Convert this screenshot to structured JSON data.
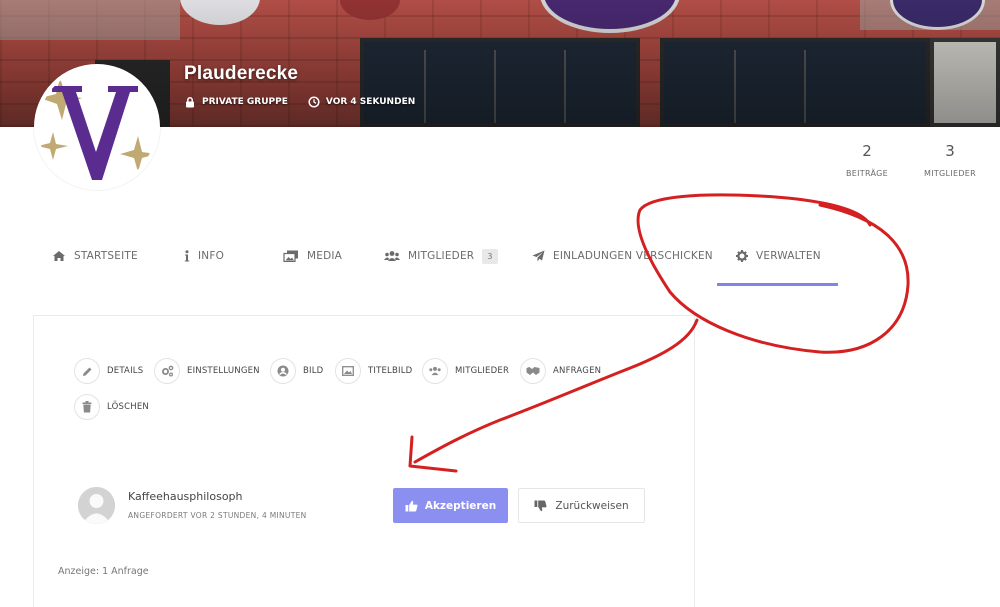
{
  "group": {
    "title": "Plauderecke",
    "privacy": "PRIVATE GRUPPE",
    "activity": "VOR 4 SEKUNDEN"
  },
  "stats": [
    {
      "value": "2",
      "label": "BEITRÄGE"
    },
    {
      "value": "3",
      "label": "MITGLIEDER"
    }
  ],
  "tabs": [
    {
      "label": "STARTSEITE",
      "icon": "home-icon"
    },
    {
      "label": "INFO",
      "icon": "info-icon"
    },
    {
      "label": "MEDIA",
      "icon": "media-icon"
    },
    {
      "label": "MITGLIEDER",
      "icon": "users-icon",
      "count": "3"
    },
    {
      "label": "EINLADUNGEN VERSCHICKEN",
      "icon": "paper-plane-icon"
    },
    {
      "label": "VERWALTEN",
      "icon": "gear-icon",
      "active": true
    }
  ],
  "manage_nav": [
    {
      "label": "DETAILS",
      "icon": "pencil-icon"
    },
    {
      "label": "EINSTELLUNGEN",
      "icon": "cogs-icon"
    },
    {
      "label": "BILD",
      "icon": "user-circle-icon"
    },
    {
      "label": "TITELBILD",
      "icon": "image-icon"
    },
    {
      "label": "MITGLIEDER",
      "icon": "users-icon"
    },
    {
      "label": "ANFRAGEN",
      "icon": "handshake-icon"
    },
    {
      "label": "LÖSCHEN",
      "icon": "trash-icon"
    }
  ],
  "request": {
    "name": "Kaffeehausphilosoph",
    "requested": "ANGEFORDERT VOR 2 STUNDEN, 4 MINUTEN",
    "accept_label": "Akzeptieren",
    "reject_label": "Zurückweisen"
  },
  "pagination": "Anzeige: 1 Anfrage",
  "colors": {
    "accent": "#8b8ff0",
    "tab_underline": "#7f86e6",
    "annotation": "#d42020",
    "logo_violet": "#5b2c8f",
    "logo_gold": "#b59a5a"
  }
}
